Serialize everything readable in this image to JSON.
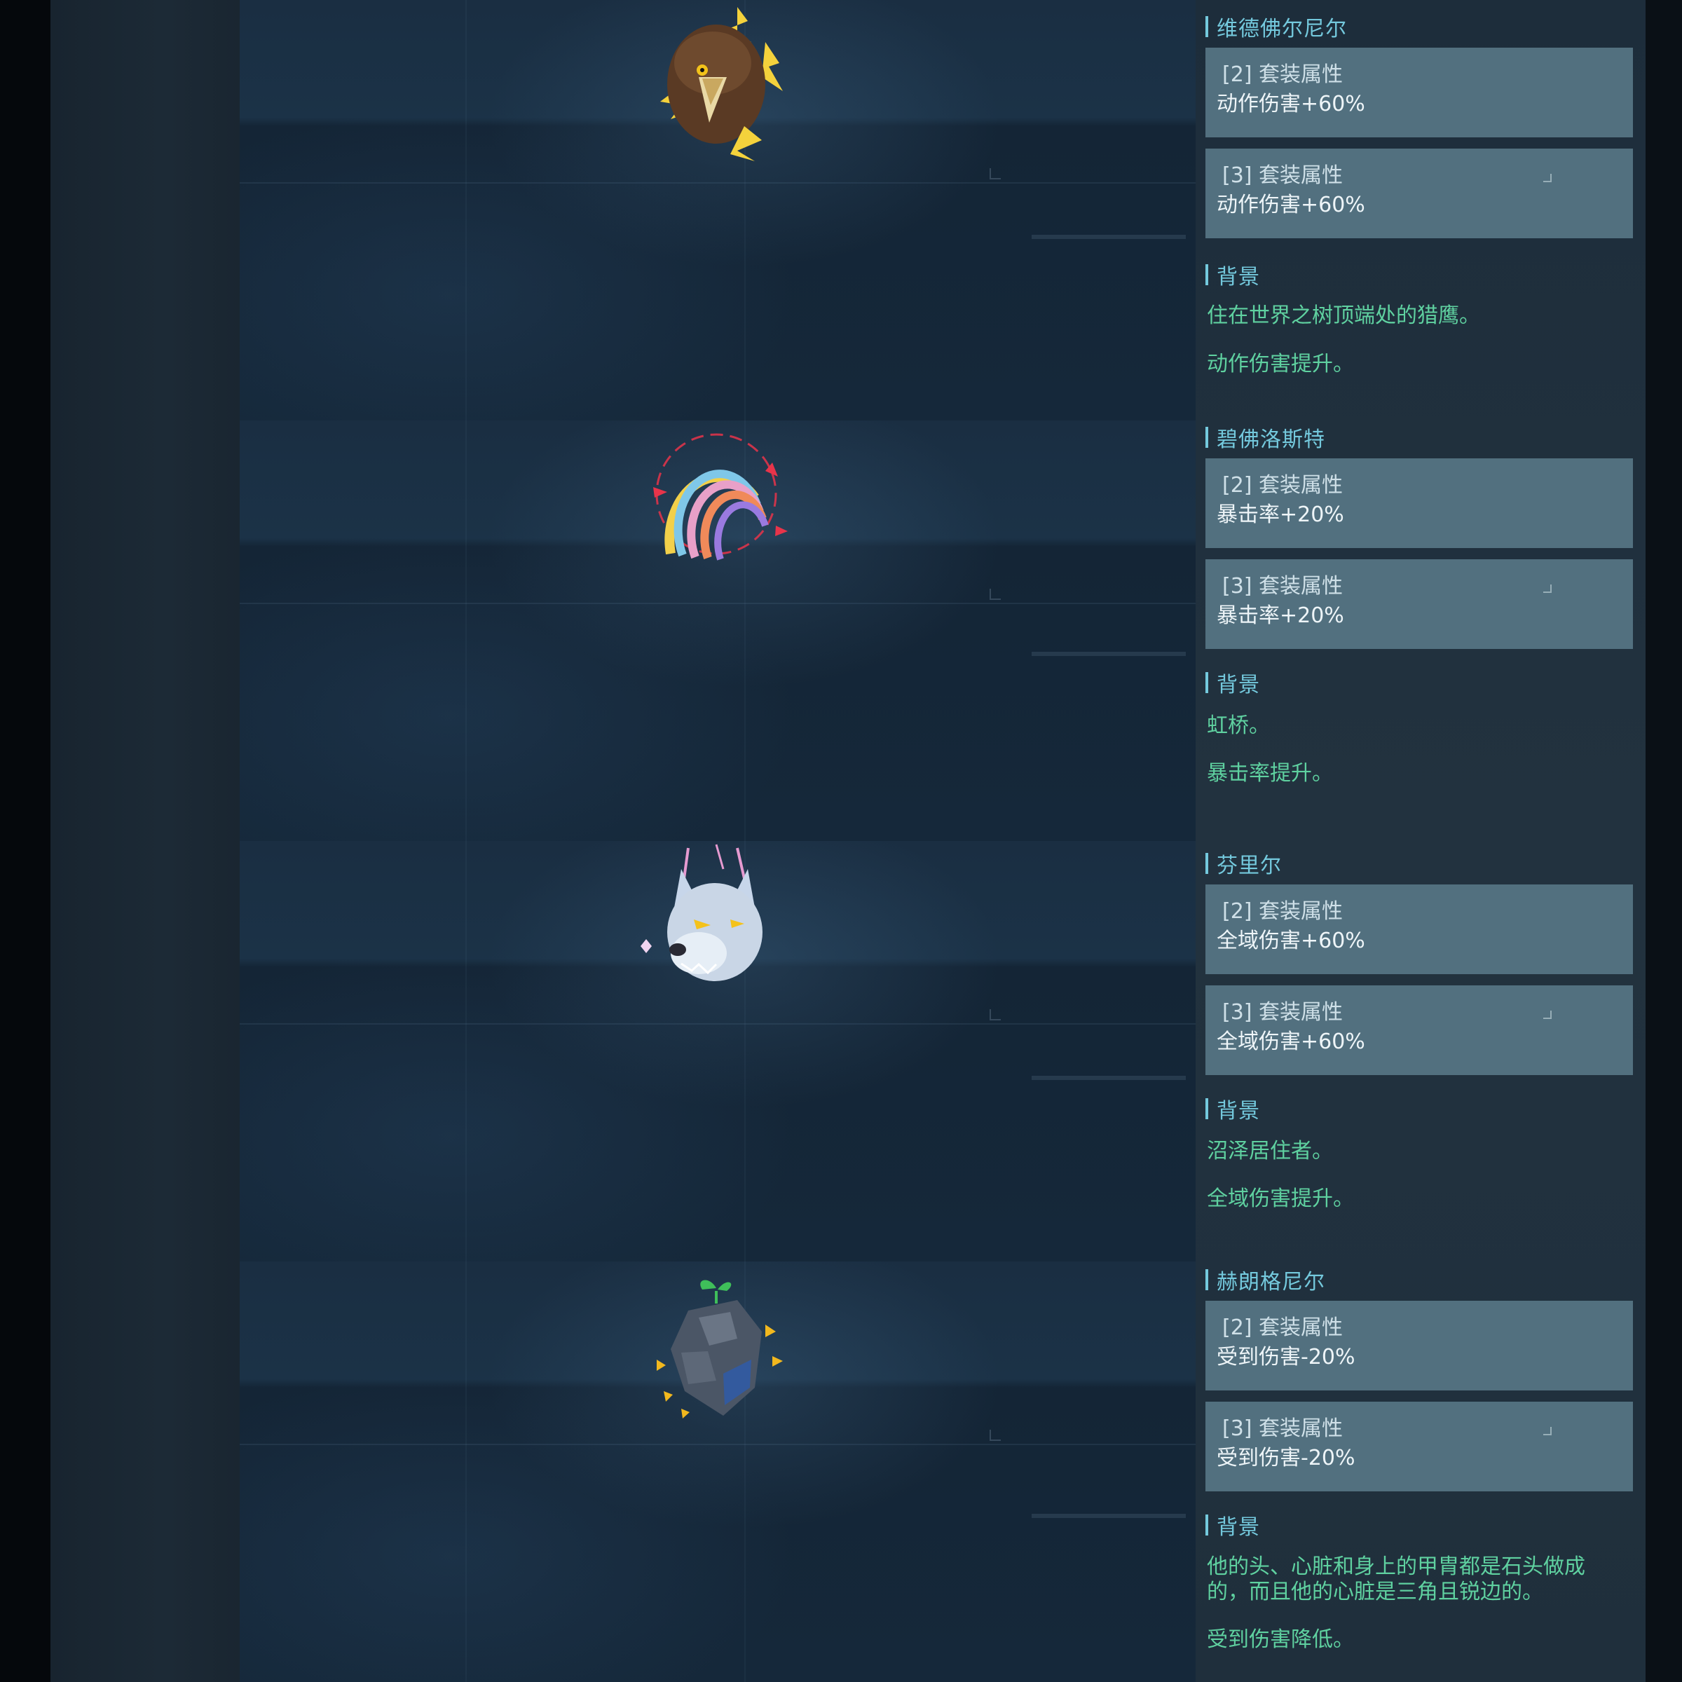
{
  "entries": [
    {
      "name": "维德佛尔尼尔",
      "icon": "eagle-icon",
      "set2_label": "[2] 套装属性",
      "set2_value": "动作伤害+60%",
      "set3_label": "[3] 套装属性",
      "set3_value": "动作伤害+60%",
      "background_heading": "背景",
      "background_text": "住在世界之树顶端处的猎鹰。",
      "effect_text": "动作伤害提升。"
    },
    {
      "name": "碧佛洛斯特",
      "icon": "rainbow-bridge-icon",
      "set2_label": "[2] 套装属性",
      "set2_value": "暴击率+20%",
      "set3_label": "[3] 套装属性",
      "set3_value": "暴击率+20%",
      "background_heading": "背景",
      "background_text": "虹桥。",
      "effect_text": "暴击率提升。"
    },
    {
      "name": "芬里尔",
      "icon": "wolf-icon",
      "set2_label": "[2] 套装属性",
      "set2_value": "全域伤害+60%",
      "set3_label": "[3] 套装属性",
      "set3_value": "全域伤害+60%",
      "background_heading": "背景",
      "background_text": "沼泽居住者。",
      "effect_text": "全域伤害提升。"
    },
    {
      "name": "赫朗格尼尔",
      "icon": "stone-heart-icon",
      "set2_label": "[2] 套装属性",
      "set2_value": "受到伤害-20%",
      "set3_label": "[3] 套装属性",
      "set3_value": "受到伤害-20%",
      "background_heading": "背景",
      "background_text": "他的头、心脏和身上的甲胄都是石头做成的，而且他的心脏是三角且锐边的。",
      "effect_text": "受到伤害降低。"
    }
  ],
  "colors": {
    "heading": "#74c9dd",
    "background_text": "#5fd1a0",
    "attr_box": "#52707f",
    "panel": "#22323f"
  }
}
